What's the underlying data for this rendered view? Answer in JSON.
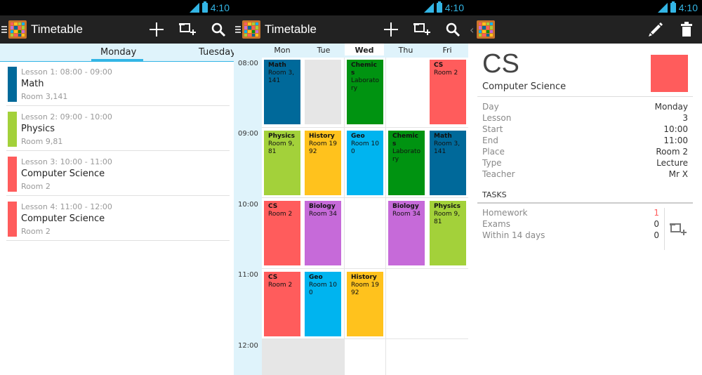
{
  "status": {
    "time": "4:10"
  },
  "app": {
    "title": "Timetable"
  },
  "colors": {
    "math": "#00699a",
    "physics": "#a3d13a",
    "cs": "#ff5c5c",
    "history": "#ffc21d",
    "geo": "#00b4ef",
    "chemistry": "#009311",
    "biology": "#c66ad9",
    "accent": "#33b5e5"
  },
  "list": {
    "tabs": {
      "active": "Monday",
      "next": "Tuesday"
    },
    "lessons": [
      {
        "time": "Lesson 1: 08:00 - 09:00",
        "subject": "Math",
        "room": "Room 3,141"
      },
      {
        "time": "Lesson 2: 09:00 - 10:00",
        "subject": "Physics",
        "room": "Room 9,81"
      },
      {
        "time": "Lesson 3: 10:00 - 11:00",
        "subject": "Computer Science",
        "room": "Room 2"
      },
      {
        "time": "Lesson 4: 11:00 - 12:00",
        "subject": "Computer Science",
        "room": "Room 2"
      }
    ]
  },
  "grid": {
    "days": [
      "Mon",
      "Tue",
      "Wed",
      "Thu",
      "Fri"
    ],
    "times": [
      "08:00",
      "09:00",
      "10:00",
      "11:00",
      "12:00"
    ],
    "cells": [
      {
        "t1": "Math",
        "t2": "Room 3,141"
      },
      {
        "t1": "Chemics",
        "t2": "Laboratory"
      },
      {
        "t1": "CS",
        "t2": "Room 2"
      },
      {
        "t1": "Physics",
        "t2": "Room 9,81"
      },
      {
        "t1": "History",
        "t2": "Room 1992"
      },
      {
        "t1": "Geo",
        "t2": "Room 100"
      },
      {
        "t1": "Chemics",
        "t2": "Laboratory"
      },
      {
        "t1": "Math",
        "t2": "Room 3,141"
      },
      {
        "t1": "CS",
        "t2": "Room 2"
      },
      {
        "t1": "Biology",
        "t2": "Room 34"
      },
      {
        "t1": "Biology",
        "t2": "Room 34"
      },
      {
        "t1": "Physics",
        "t2": "Room 9,81"
      },
      {
        "t1": "CS",
        "t2": "Room 2"
      },
      {
        "t1": "Geo",
        "t2": "Room 100"
      },
      {
        "t1": "History",
        "t2": "Room 1992"
      }
    ]
  },
  "detail": {
    "code": "CS",
    "name": "Computer Science",
    "fields": [
      {
        "k": "Day",
        "v": "Monday"
      },
      {
        "k": "Lesson",
        "v": "3"
      },
      {
        "k": "Start",
        "v": "10:00"
      },
      {
        "k": "End",
        "v": "11:00"
      },
      {
        "k": "Place",
        "v": "Room 2"
      },
      {
        "k": "Type",
        "v": "Lecture"
      },
      {
        "k": "Teacher",
        "v": "Mr X"
      }
    ],
    "tasks_title": "TASKS",
    "tasks": [
      {
        "k": "Homework",
        "v": "1"
      },
      {
        "k": "Exams",
        "v": "0"
      },
      {
        "k": "Within 14 days",
        "v": "0"
      }
    ]
  }
}
